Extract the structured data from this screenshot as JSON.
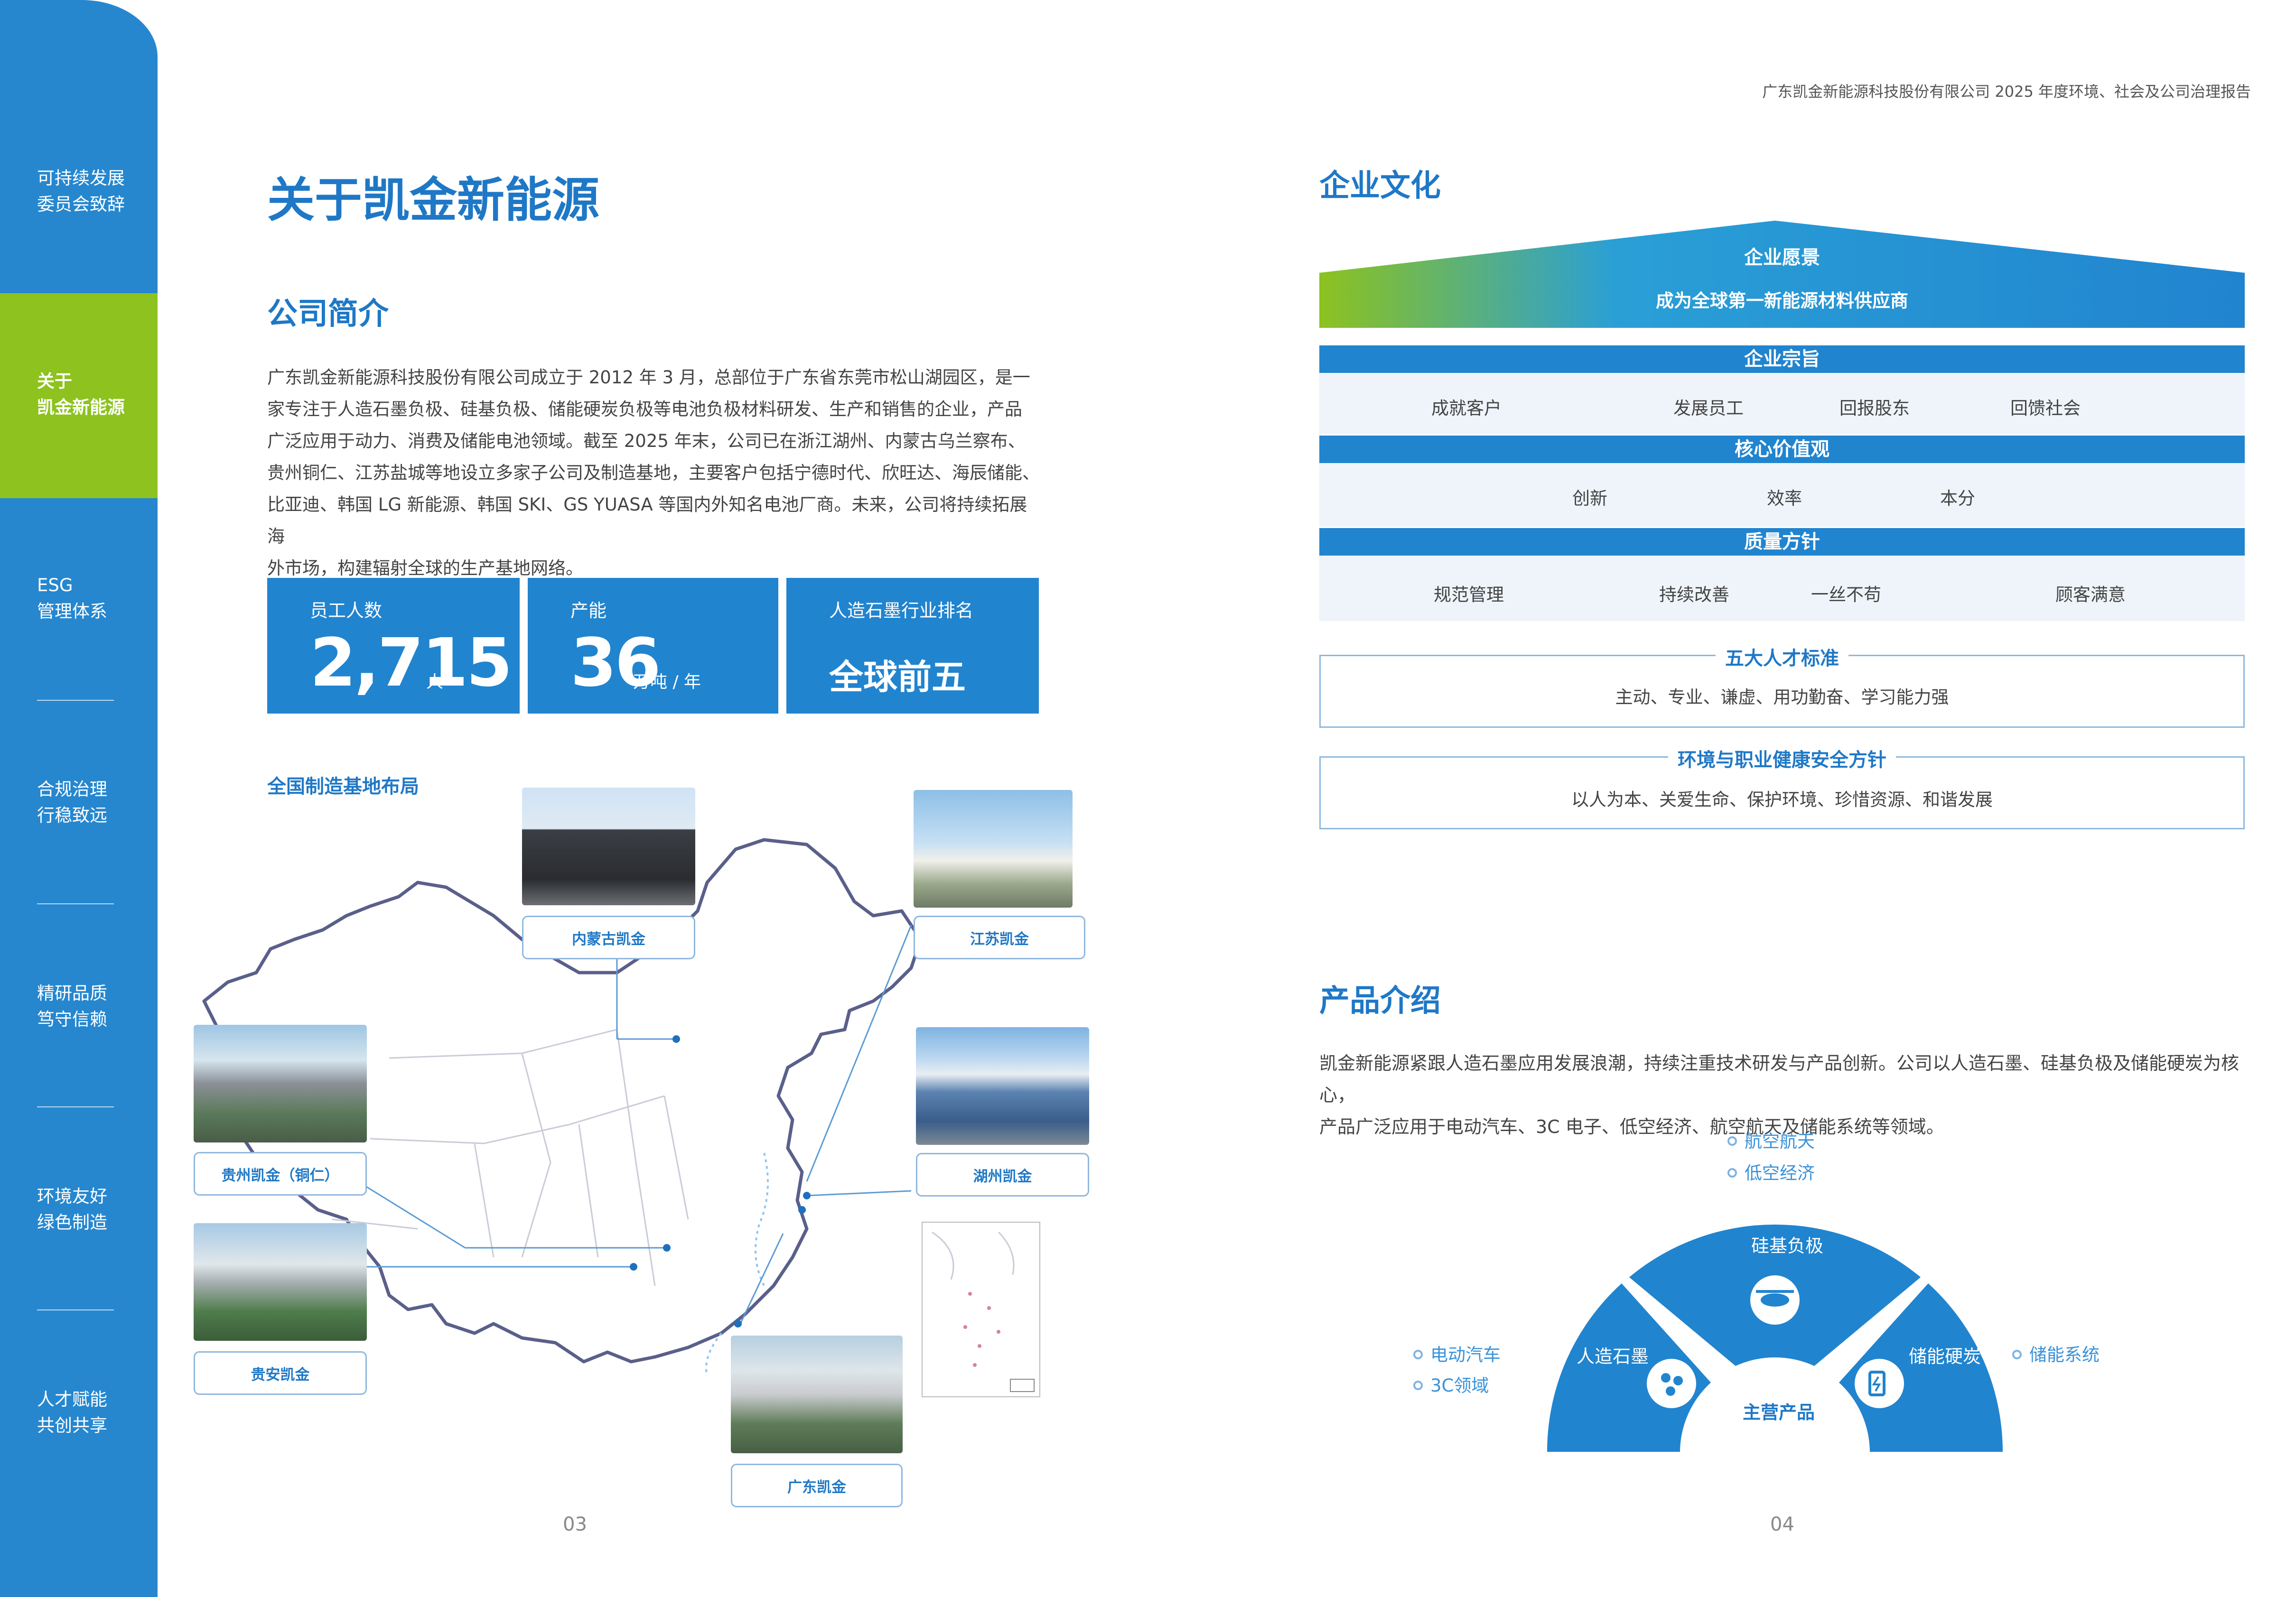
{
  "header": {
    "doc_title": "广东凯金新能源科技股份有限公司   2025 年度环境、社会及公司治理报告"
  },
  "sidebar": {
    "items": [
      {
        "line1": "可持续发展",
        "line2": "委员会致辞"
      },
      {
        "line1": "关于",
        "line2": "凯金新能源"
      },
      {
        "line1": "ESG",
        "line2": "管理体系"
      },
      {
        "line1": "合规治理",
        "line2": "行稳致远"
      },
      {
        "line1": "精研品质",
        "line2": "笃守信赖"
      },
      {
        "line1": "环境友好",
        "line2": "绿色制造"
      },
      {
        "line1": "人才赋能",
        "line2": "共创共享"
      }
    ]
  },
  "left": {
    "page_title": "关于凯金新能源",
    "section_title": "公司简介",
    "intro_lines": [
      "广东凯金新能源科技股份有限公司成立于 2012 年 3 月，总部位于广东省东莞市松山湖园区，是一",
      "家专注于人造石墨负极、硅基负极、储能硬炭负极等电池负极材料研发、生产和销售的企业，产品",
      "广泛应用于动力、消费及储能电池领域。截至 2025 年末，公司已在浙江湖州、内蒙古乌兰察布、",
      "贵州铜仁、江苏盐城等地设立多家子公司及制造基地，主要客户包括宁德时代、欣旺达、海辰储能、",
      "比亚迪、韩国 LG 新能源、韩国 SKI、GS YUASA 等国内外知名电池厂商。未来，公司将持续拓展海",
      "外市场，构建辐射全球的生产基地网络。"
    ],
    "stats": {
      "employees": {
        "label": "员工人数",
        "value": "2,715",
        "unit": "人"
      },
      "capacity": {
        "label": "产能",
        "value": "36",
        "unit": "万吨 / 年"
      },
      "rank": {
        "label": "人造石墨行业排名",
        "value": "全球前五"
      }
    },
    "map_title": "全国制造基地布局",
    "bases": {
      "neimenggu": "内蒙古凯金",
      "jiangsu": "江苏凯金",
      "guizhou": "贵州凯金（铜仁）",
      "huzhou": "湖州凯金",
      "guian": "贵安凯金",
      "guangdong": "广东凯金"
    },
    "page_number": "03"
  },
  "right": {
    "culture_title": "企业文化",
    "vision": {
      "label": "企业愿景",
      "text": "成为全球第一新能源材料供应商"
    },
    "purpose": {
      "label": "企业宗旨",
      "items": [
        "成就客户",
        "发展员工",
        "回报股东",
        "回馈社会"
      ]
    },
    "values": {
      "label": "核心价值观",
      "items": [
        "创新",
        "效率",
        "本分"
      ]
    },
    "quality": {
      "label": "质量方针",
      "items": [
        "规范管理",
        "持续改善",
        "一丝不苟",
        "顾客满意"
      ]
    },
    "talent": {
      "label": "五大人才标准",
      "text": "主动、专业、谦虚、用功勤奋、学习能力强"
    },
    "ehs": {
      "label": "环境与职业健康安全方针",
      "text": "以人为本、关爱生命、保护环境、珍惜资源、和谐发展"
    },
    "product_title": "产品介绍",
    "product_lines": [
      "凯金新能源紧跟人造石墨应用发展浪潮，持续注重技术研发与产品创新。公司以人造石墨、硅基负极及储能硬炭为核心，",
      "产品广泛应用于电动汽车、3C 电子、低空经济、航空航天及储能系统等领域。"
    ],
    "products": {
      "center": "主营产品",
      "artificial_graphite": "人造石墨",
      "silicon_anode": "硅基负极",
      "hard_carbon": "储能硬炭"
    },
    "applications": {
      "aerospace": "航空航天",
      "low_altitude": "低空经济",
      "ev": "电动汽车",
      "three_c": "3C领域",
      "storage": "储能系统"
    },
    "page_number": "04"
  },
  "colors": {
    "primary_blue": "#2184cf",
    "title_blue": "#1f78c6",
    "accent_green": "#8dc21f",
    "light_band": "#eef4fa"
  }
}
